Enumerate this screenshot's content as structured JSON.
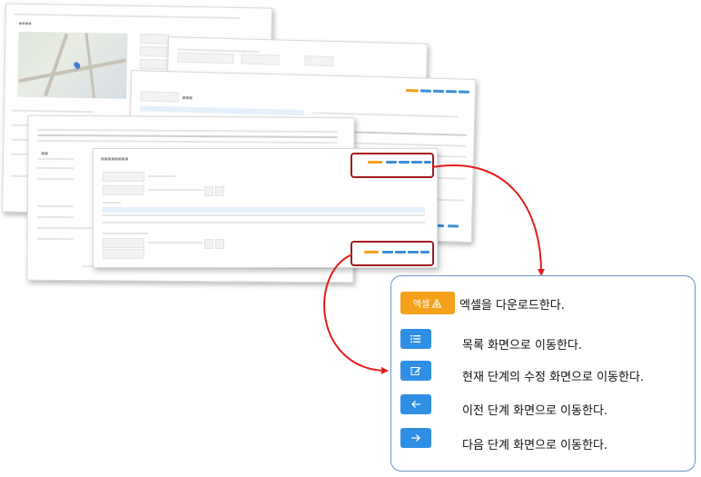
{
  "buttons": [
    {
      "label": "엑셀",
      "icon": "download-icon",
      "color": "#f5a11c",
      "description": "엑셀을 다운로드한다."
    },
    {
      "label": "",
      "icon": "list-icon",
      "color": "#2f8fe4",
      "description": "목록 화면으로 이동한다."
    },
    {
      "label": "",
      "icon": "edit-icon",
      "color": "#2f8fe4",
      "description": "현재 단계의 수정 화면으로 이동한다."
    },
    {
      "label": "",
      "icon": "arrow-left-icon",
      "color": "#2f8fe4",
      "description": "이전 단계 화면으로 이동한다."
    },
    {
      "label": "",
      "icon": "arrow-right-icon",
      "color": "#2f8fe4",
      "description": "다음 단계 화면으로 이동한다."
    }
  ],
  "colors": {
    "highlight": "#a31b1b",
    "callout_border": "#6b96c8",
    "arrow": "#e41b1b"
  }
}
